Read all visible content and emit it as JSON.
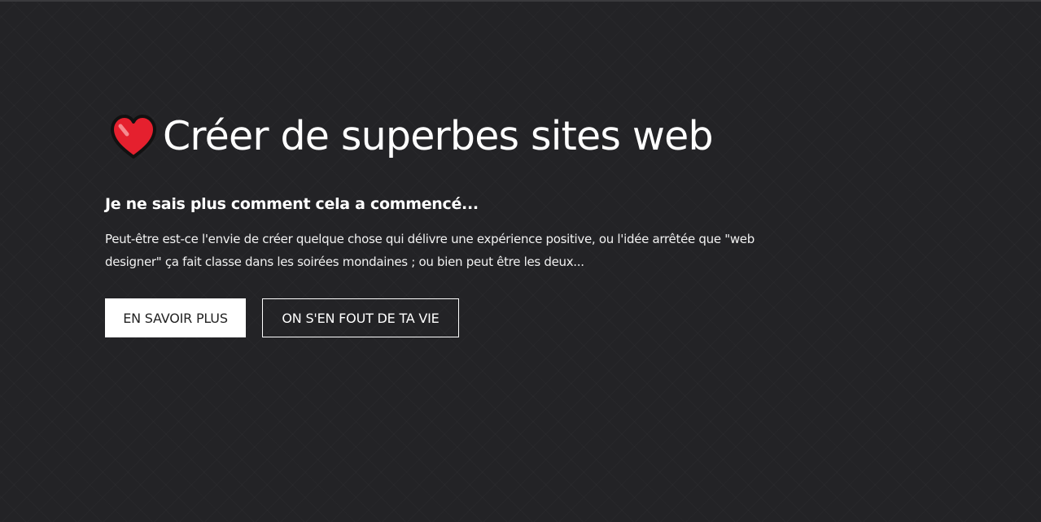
{
  "hero": {
    "icon": "heart-icon",
    "title": "Créer de superbes sites web",
    "subtitle": "Je ne sais plus comment cela a commencé...",
    "description": "Peut-être est-ce l'envie de créer quelque chose qui délivre une expérience positive, ou l'idée arrêtée que \"web designer\" ça fait classe dans les soirées mondaines ; ou bien peut être les deux...",
    "buttons": {
      "primary_label": "EN SAVOIR PLUS",
      "secondary_label": "ON S'EN FOUT DE TA VIE"
    }
  },
  "colors": {
    "background": "#232326",
    "heart": "#e5202e",
    "text": "#ffffff"
  }
}
